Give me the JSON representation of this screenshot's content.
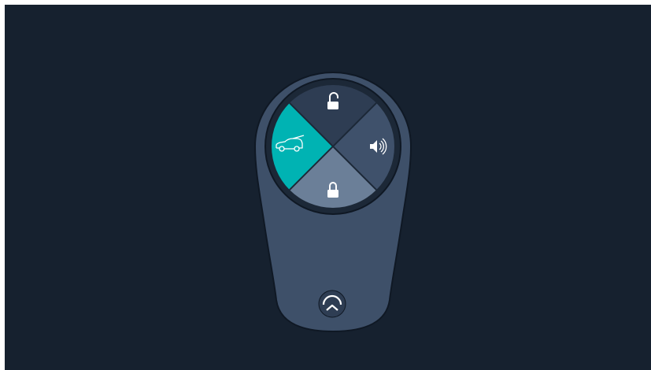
{
  "colors": {
    "background": "#16212f",
    "fob_body": "#3e5069",
    "fob_outline": "#0f1824",
    "ring": "#1c2837",
    "button_top": "#2e3d53",
    "button_right": "#3f516b",
    "button_bottom": "#6b7f98",
    "button_left_active": "#00b3b3",
    "icon": "#ffffff"
  },
  "buttons": [
    {
      "name": "unlock",
      "icon": "unlock-icon",
      "active": false
    },
    {
      "name": "panic-alarm",
      "icon": "speaker-icon",
      "active": false
    },
    {
      "name": "lock",
      "icon": "lock-icon",
      "active": false
    },
    {
      "name": "trunk",
      "icon": "car-trunk-icon",
      "active": true
    }
  ],
  "logo": "nio-logo-icon"
}
